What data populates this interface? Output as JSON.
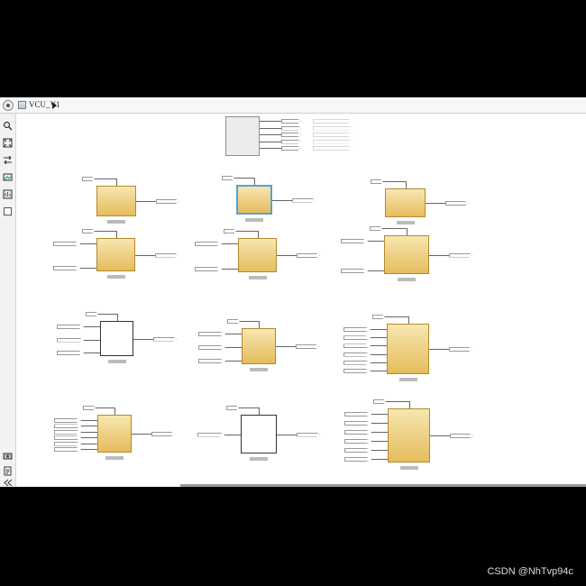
{
  "address_bar": {
    "breadcrumb": "VCU_V1"
  },
  "toolbar": {
    "tools": [
      "back-icon",
      "zoom-icon",
      "fit-view-icon",
      "arrows-icon",
      "image-icon",
      "library-icon",
      "square-icon",
      "camera-icon",
      "report-icon",
      "collapse-icon"
    ]
  },
  "watermark": "CSDN @NhTvp94c",
  "colors": {
    "block_fill": "#efd38a",
    "block_border": "#b38a2d",
    "selection": "#5aa0d8",
    "canvas": "#ffffff"
  }
}
